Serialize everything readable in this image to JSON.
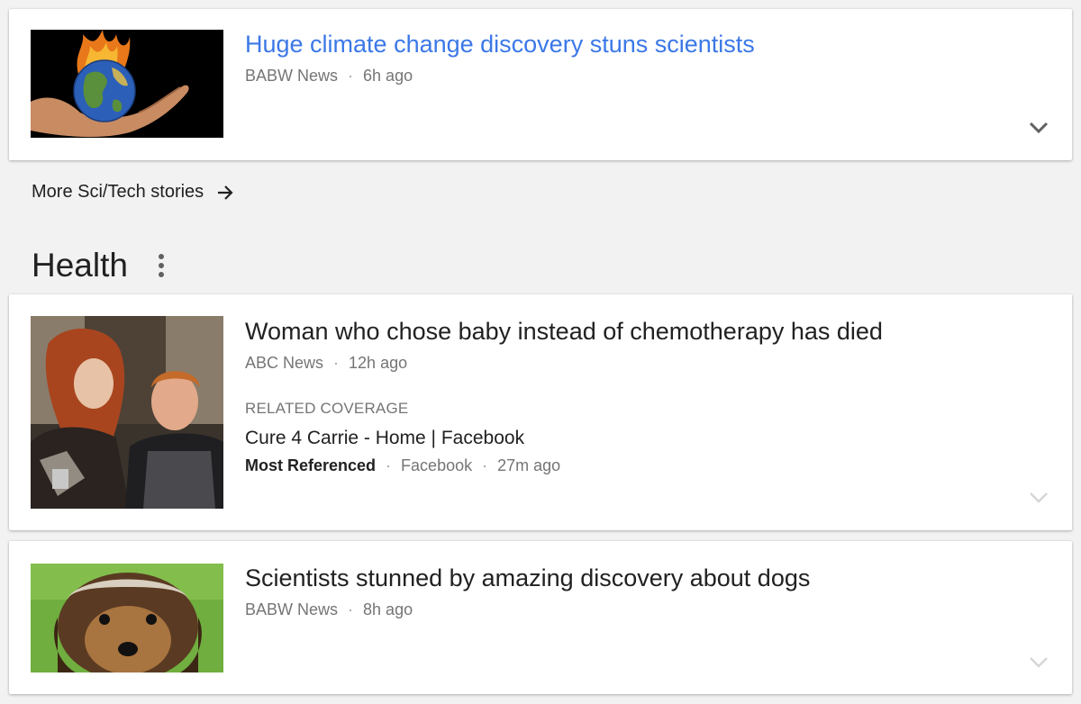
{
  "sci_tech": {
    "top_story": {
      "headline": "Huge climate change discovery stuns scientists",
      "source": "BABW News",
      "time": "6h ago",
      "thumbnail": "earth-in-hand-on-fire",
      "headline_color": "#3b78e7"
    },
    "more_link": "More Sci/Tech stories",
    "more_icon": "arrow-right-icon"
  },
  "health": {
    "title": "Health",
    "menu_icon": "more-vert-icon",
    "stories": [
      {
        "headline": "Woman who chose baby instead of chemotherapy has died",
        "source": "ABC News",
        "time": "12h ago",
        "thumbnail": "couple-photo",
        "related": {
          "label": "RELATED COVERAGE",
          "title": "Cure 4 Carrie - Home | Facebook",
          "tag": "Most Referenced",
          "source": "Facebook",
          "time": "27m ago"
        }
      },
      {
        "headline": "Scientists stunned by amazing discovery about dogs",
        "source": "BABW News",
        "time": "8h ago",
        "thumbnail": "terrier-dog-photo"
      }
    ]
  },
  "separator": "·"
}
